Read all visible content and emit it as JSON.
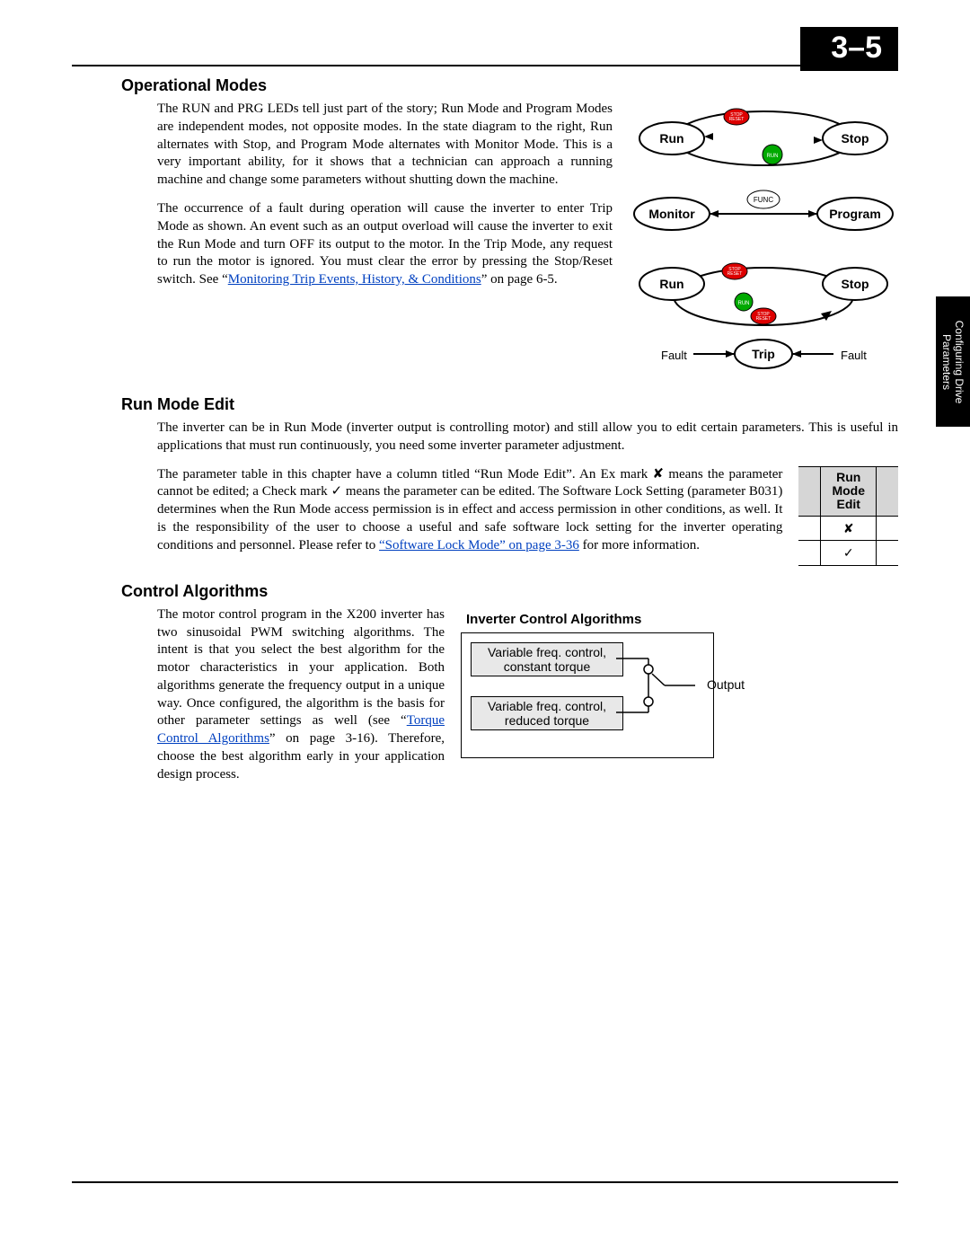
{
  "page_number": "3–5",
  "edge_tab": "Configuring Drive\nParameters",
  "sections": {
    "op_modes": {
      "heading": "Operational Modes",
      "para1_a": "The RUN and PRG LEDs tell just part of the story; Run Mode and Program Modes are independent modes, not opposite modes. In the state diagram to the right, Run alternates with Stop, and Program Mode alternates with Monitor Mode. This is a very important ability, for it shows that a technician can approach a running machine and change some parameters without shutting down the machine.",
      "para2_a": "The occurrence of a fault during operation will cause the inverter to enter Trip Mode as shown. An event such as an output overload will cause the inverter to exit the Run Mode and turn OFF its output to the motor. In the Trip Mode, any request to run the motor is ignored. You must clear the error by pressing the Stop/Reset switch. See “",
      "para2_link": "Monitoring Trip Events, History, & Conditions",
      "para2_b": "” on page 6-5.",
      "diagram1": {
        "run": "Run",
        "stop": "Stop",
        "monitor": "Monitor",
        "program": "Program",
        "func": "FUNC",
        "btn_stop": "STOP\nRESET",
        "btn_run": "RUN"
      },
      "diagram2": {
        "run": "Run",
        "stop": "Stop",
        "trip": "Trip",
        "fault_l": "Fault",
        "fault_r": "Fault",
        "btn_stop": "STOP\nRESET",
        "btn_run": "RUN"
      }
    },
    "run_mode": {
      "heading": "Run Mode Edit",
      "para1": "The inverter can be in Run Mode (inverter output is controlling motor) and still allow you to edit certain parameters. This is useful in applications that must run continuously, you need some inverter parameter adjustment.",
      "para2_a": "The parameter table in this chapter have a column titled “Run Mode Edit”. An Ex mark  ✘  means the parameter cannot be edited; a Check mark  ✓  means the parameter can be edited. The Software Lock Setting (parameter B031) determines when the Run Mode access permission is in effect and access permission in other conditions, as well. It is the responsibility of the user to choose a useful and safe software lock setting for the inverter operating conditions and personnel. Please refer to ",
      "para2_link": "“Software Lock Mode” on page 3-36",
      "para2_b": " for more information.",
      "table": {
        "header": "Run\nMode\nEdit",
        "r1": "✘",
        "r2": "✓"
      }
    },
    "control_alg": {
      "heading": "Control Algorithms",
      "para_a": "The motor control program in the X200 inverter has two sinusoidal PWM switching algorithms. The intent is that you select the best algorithm for the motor characteristics in your application. Both algorithms generate the frequency output in a unique way. Once configured, the algorithm is the basis for other parameter settings as well (see “",
      "para_link": "Torque Control Algorithms",
      "para_b": "” on page 3-16). Therefore, choose the best algorithm early in your application design process.",
      "figure": {
        "title": "Inverter Control Algorithms",
        "item1": "Variable freq. control,\nconstant torque",
        "item2": "Variable freq. control,\nreduced torque",
        "output": "Output"
      }
    }
  }
}
